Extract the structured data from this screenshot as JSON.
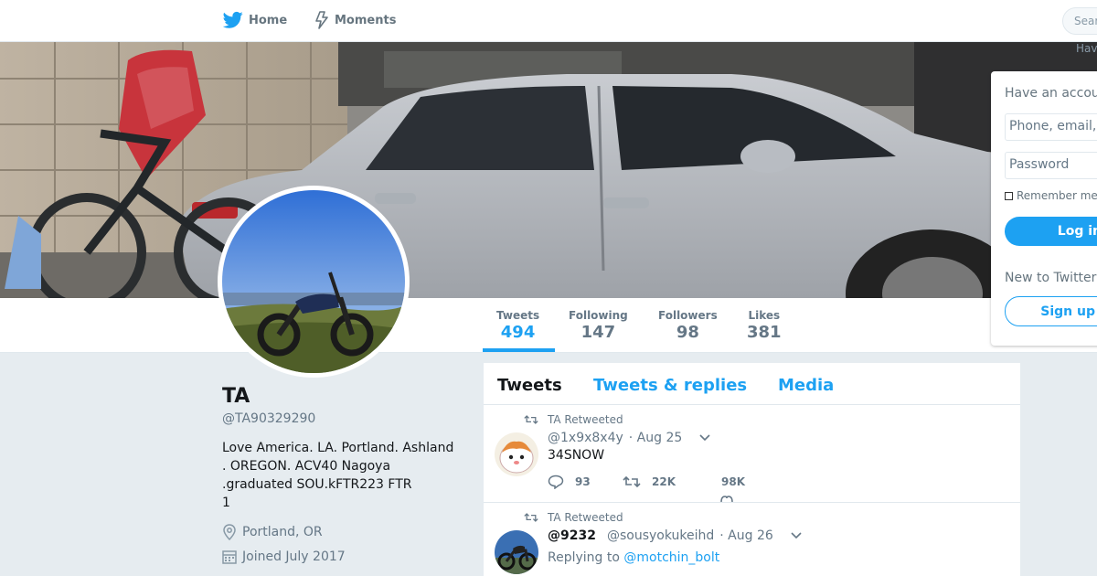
{
  "nav": {
    "home_label": "Home",
    "moments_label": "Moments",
    "search_placeholder": "Search"
  },
  "colors": {
    "accent": "#1da1f2",
    "page_background": "#e6ecf0"
  },
  "profile": {
    "name": "TA",
    "handle": "@TA90329290",
    "bio": "Love America. LA. Portland. Ashland\n. OREGON. ACV40 Nagoya\n.graduated SOU.kFTR223 FTR\n 1",
    "location": "Portland, OR",
    "joined": "Joined July 2017",
    "icons": {
      "location": "location-pin-icon",
      "joined": "calendar-icon"
    }
  },
  "stats": [
    {
      "label": "Tweets",
      "value": "494",
      "active": true
    },
    {
      "label": "Following",
      "value": "147",
      "active": false
    },
    {
      "label": "Followers",
      "value": "98",
      "active": false
    },
    {
      "label": "Likes",
      "value": "381",
      "active": false
    }
  ],
  "login": {
    "corner_text": "Hav",
    "have_account": "Have an account?",
    "phone_placeholder": "Phone, email, or username",
    "password_placeholder": "Password",
    "remember_me": "Remember me",
    "login_button": "Log in",
    "new_to_twitter": "New to Twitter?",
    "signup_button": "Sign up"
  },
  "timeline": {
    "tabs": [
      {
        "label": "Tweets",
        "active": true
      },
      {
        "label": "Tweets & replies",
        "active": false
      },
      {
        "label": "Media",
        "active": false
      }
    ],
    "tweets": [
      {
        "retweet_context": "TA Retweeted",
        "fullname": "",
        "username": "@1x9x8x4y",
        "time": "· Aug 25",
        "text": "34SNOW",
        "replies": "93",
        "retweets": "22K",
        "likes": "98K"
      },
      {
        "retweet_context": "TA Retweeted",
        "fullname": "@9232",
        "username": "@sousyokukeihd",
        "time": "· Aug 26",
        "replying_prefix": "Replying to",
        "replying_to": "@motchin_bolt"
      }
    ]
  }
}
